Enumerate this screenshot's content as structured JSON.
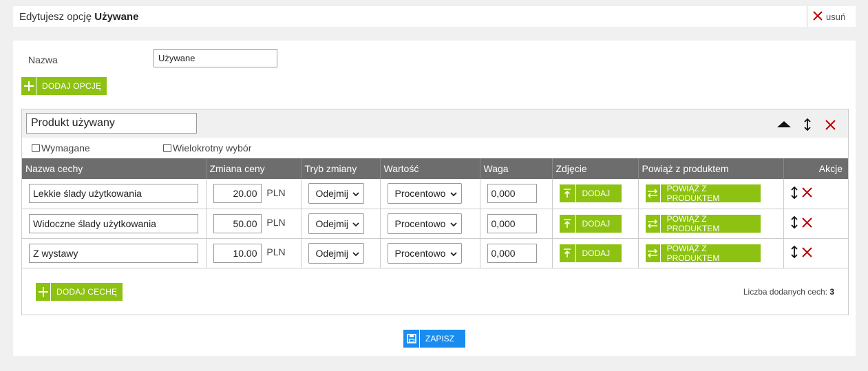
{
  "header": {
    "title_prefix": "Edytujesz opcję",
    "title_name": "Używane",
    "delete_label": "usuń"
  },
  "form": {
    "name_label": "Nazwa",
    "name_value": "Używane",
    "add_option_label": "DODAJ OPCJĘ"
  },
  "group": {
    "name_value": "Produkt używany",
    "required_label": "Wymagane",
    "required_checked": false,
    "multi_label": "Wielokrotny wybór",
    "multi_checked": false
  },
  "table": {
    "columns": [
      "Nazwa cechy",
      "Zmiana ceny",
      "Tryb zmiany",
      "Wartość",
      "Waga",
      "Zdjęcie",
      "Powiąż z produktem",
      "Akcje"
    ],
    "currency": "PLN",
    "add_photo_label": "DODAJ",
    "link_product_label": "POWIĄŻ Z PRODUKTEM",
    "rows": [
      {
        "name": "Lekkie ślady użytkowania",
        "price": "20.00",
        "mode": "Odejmij",
        "value_type": "Procentowo",
        "weight": "0,000"
      },
      {
        "name": "Widoczne ślady użytkowania",
        "price": "50.00",
        "mode": "Odejmij",
        "value_type": "Procentowo",
        "weight": "0,000"
      },
      {
        "name": "Z wystawy",
        "price": "10.00",
        "mode": "Odejmij",
        "value_type": "Procentowo",
        "weight": "0,000"
      }
    ]
  },
  "footer": {
    "add_feature_label": "DODAJ CECHĘ",
    "count_label": "Liczba dodanych cech:",
    "count_value": "3",
    "save_label": "ZAPISZ"
  },
  "colors": {
    "green": "#8dc213",
    "blue": "#1a8cf0",
    "red": "#c00000",
    "table_header": "#6d6d6d"
  },
  "icons": [
    "close-icon",
    "plus-icon",
    "collapse-arrow-icon",
    "move-vertical-icon",
    "upload-icon",
    "link-arrows-icon",
    "save-icon",
    "chevron-down-icon"
  ]
}
